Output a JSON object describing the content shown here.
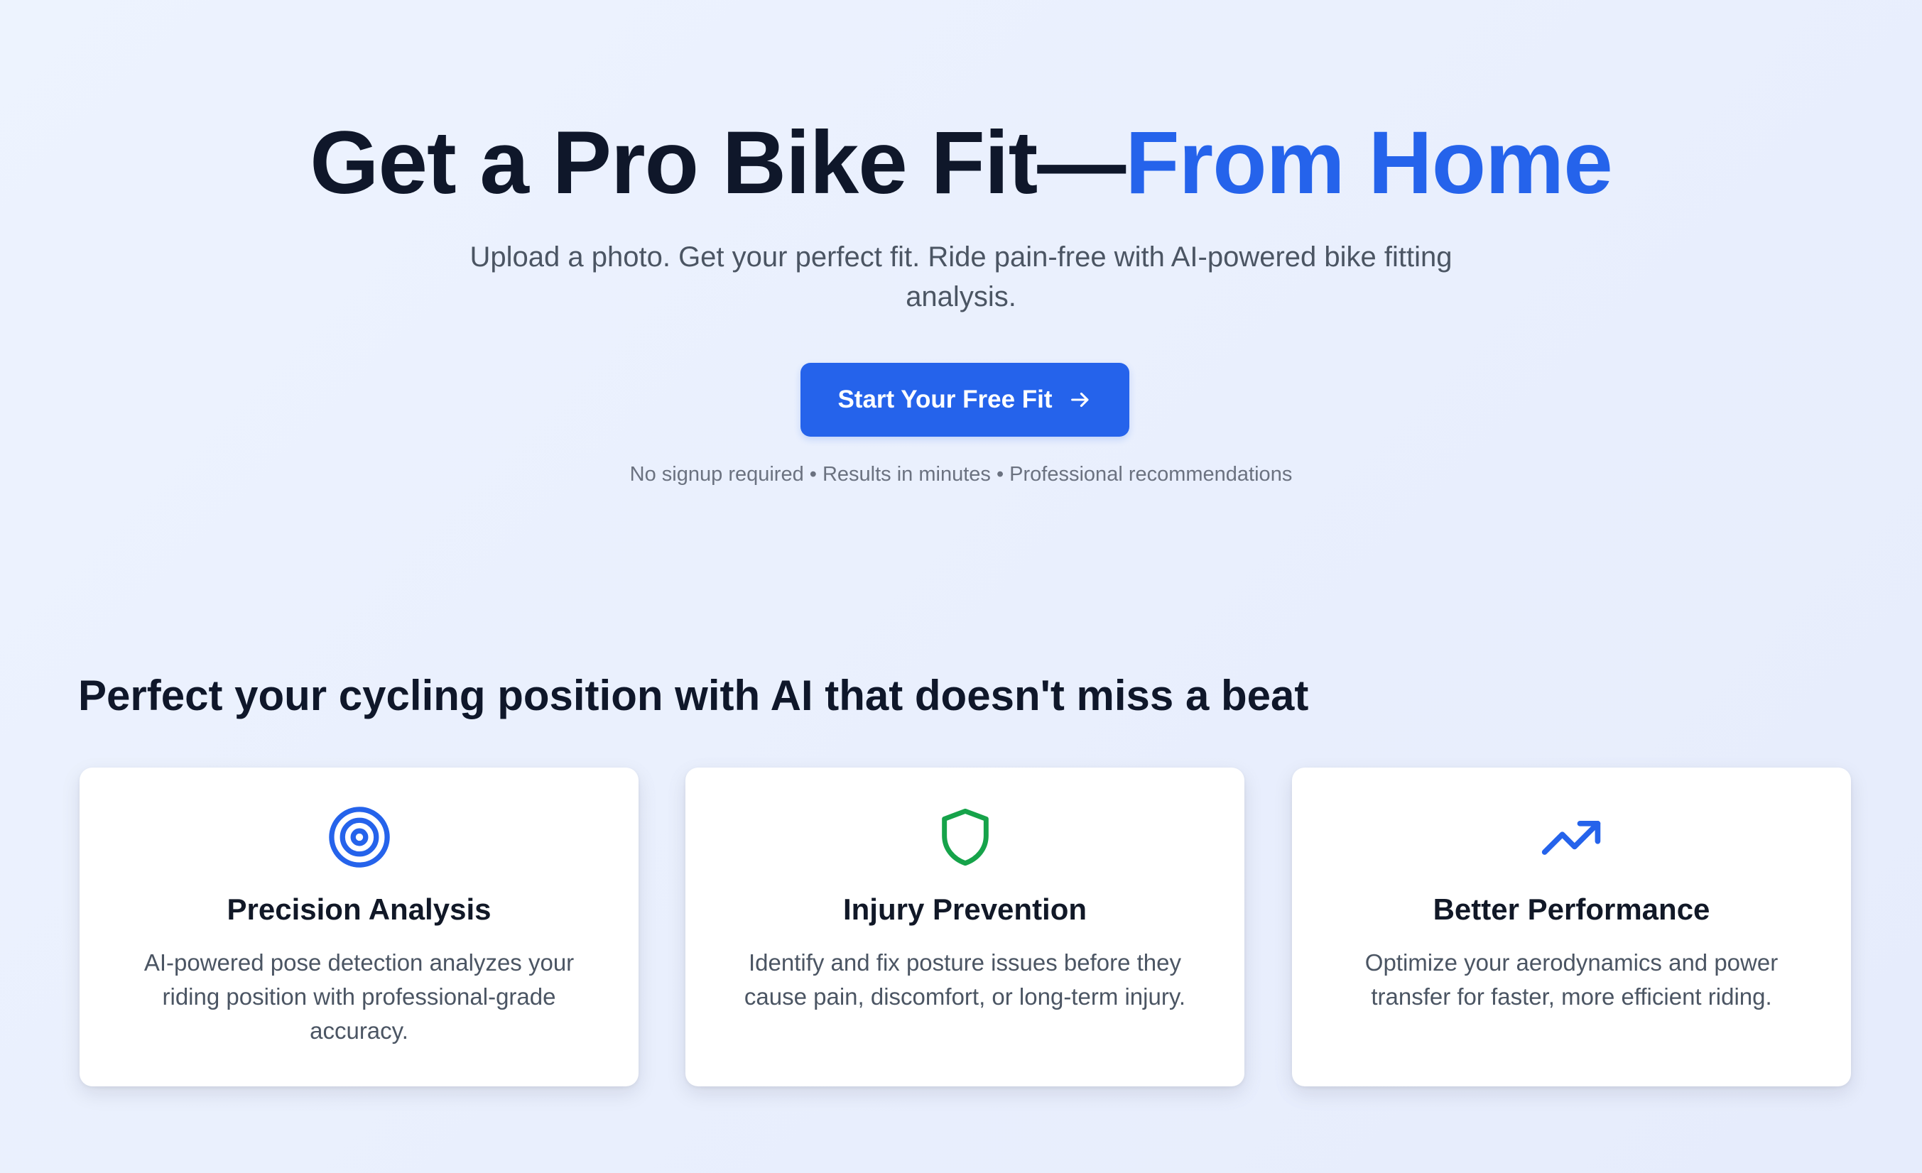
{
  "hero": {
    "title_main": "Get a Pro Bike Fit—",
    "title_accent": "From Home",
    "subtitle": "Upload a photo. Get your perfect fit. Ride pain-free with AI-powered bike fitting analysis.",
    "cta_label": "Start Your Free Fit",
    "cta_icon": "arrow-right-icon",
    "note": "No signup required • Results in minutes • Professional recommendations"
  },
  "features": {
    "heading": "Perfect your cycling position with AI that doesn't miss a beat",
    "cards": [
      {
        "icon": "target-icon",
        "icon_color": "#2563eb",
        "title": "Precision Analysis",
        "description": "AI-powered pose detection analyzes your riding position with professional-grade accuracy."
      },
      {
        "icon": "shield-icon",
        "icon_color": "#16a34a",
        "title": "Injury Prevention",
        "description": "Identify and fix posture issues before they cause pain, discomfort, or long-term injury."
      },
      {
        "icon": "trending-up-icon",
        "icon_color": "#2563eb",
        "title": "Better Performance",
        "description": "Optimize your aerodynamics and power transfer for faster, more efficient riding."
      }
    ]
  },
  "colors": {
    "accent": "#2563eb",
    "success": "#16a34a",
    "heading": "#0f172a",
    "body_text": "#4b5563",
    "muted_text": "#6b7280"
  }
}
